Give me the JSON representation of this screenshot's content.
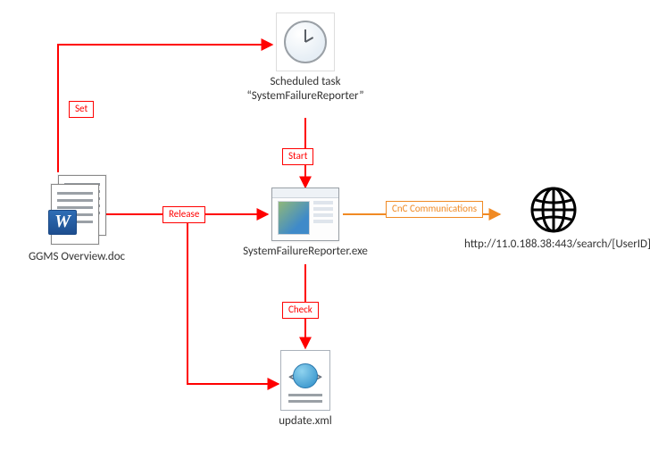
{
  "nodes": {
    "doc": {
      "label": "GGMS Overview.doc"
    },
    "task": {
      "label": "Scheduled task\n“SystemFailureReporter”"
    },
    "exe": {
      "label": "SystemFailureReporter.exe"
    },
    "xml": {
      "label": "update.xml"
    },
    "c2": {
      "label": "http://11.0.188.38:443/search/[UserID]"
    }
  },
  "edges": {
    "set": {
      "label": "Set"
    },
    "start": {
      "label": "Start"
    },
    "release": {
      "label": "Release"
    },
    "check": {
      "label": "Check"
    },
    "cnc": {
      "label": "CnC\nCommunications"
    }
  }
}
